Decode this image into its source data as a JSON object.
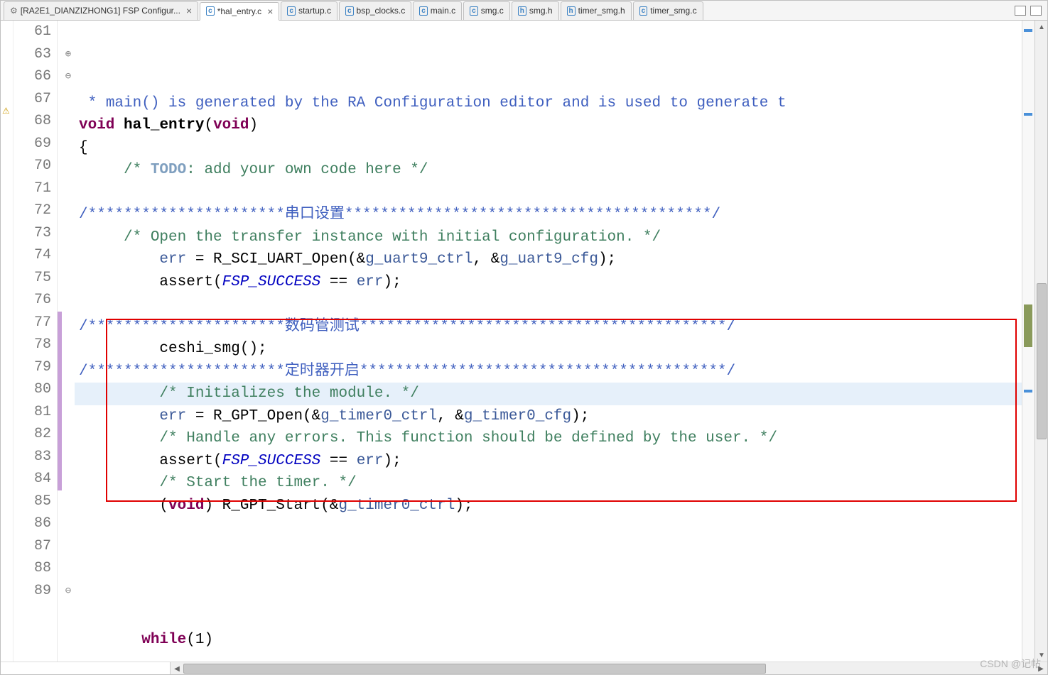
{
  "tabs": [
    {
      "label": "[RA2E1_DIANZIZHONG1] FSP Configur...",
      "icon": "gear",
      "active": false,
      "closeable": true
    },
    {
      "label": "*hal_entry.c",
      "icon": "c",
      "active": true,
      "closeable": true
    },
    {
      "label": "startup.c",
      "icon": "c",
      "active": false,
      "closeable": false
    },
    {
      "label": "bsp_clocks.c",
      "icon": "c",
      "active": false,
      "closeable": false
    },
    {
      "label": "main.c",
      "icon": "c",
      "active": false,
      "closeable": false
    },
    {
      "label": "smg.c",
      "icon": "c",
      "active": false,
      "closeable": false
    },
    {
      "label": "smg.h",
      "icon": "h",
      "active": false,
      "closeable": false
    },
    {
      "label": "timer_smg.h",
      "icon": "h",
      "active": false,
      "closeable": false
    },
    {
      "label": "timer_smg.c",
      "icon": "c",
      "active": false,
      "closeable": false
    }
  ],
  "lines": [
    {
      "num": "61",
      "fold": "",
      "ch": false,
      "cls": "",
      "html": ""
    },
    {
      "num": "63",
      "fold": "⊕",
      "ch": false,
      "cls": "",
      "html": " <span class='cm'>* main() is generated by the RA Configuration editor and is used to generate t</span>"
    },
    {
      "num": "66",
      "fold": "⊖",
      "ch": false,
      "cls": "",
      "html": "<span class='k'>void</span> <span class='fn' style='font-weight:bold'>hal_entry</span>(<span class='k'>void</span>)"
    },
    {
      "num": "67",
      "fold": "",
      "ch": false,
      "cls": "",
      "html": "{"
    },
    {
      "num": "68",
      "fold": "",
      "ch": false,
      "cls": "",
      "html": "     <span class='c'>/* </span><span class='todo'>TODO</span><span class='c'>: add your own code here */</span>"
    },
    {
      "num": "69",
      "fold": "",
      "ch": false,
      "cls": "",
      "html": ""
    },
    {
      "num": "70",
      "fold": "",
      "ch": false,
      "cls": "",
      "html": "<span class='cm'>/**********************串口设置*****************************************/</span>"
    },
    {
      "num": "71",
      "fold": "",
      "ch": false,
      "cls": "",
      "html": "     <span class='c'>/* Open the transfer instance with initial configuration. */</span>"
    },
    {
      "num": "72",
      "fold": "",
      "ch": false,
      "cls": "",
      "html": "         <span class='var'>err</span> = R_SCI_UART_Open(&amp;<span class='var'>g_uart9_ctrl</span>, &amp;<span class='var'>g_uart9_cfg</span>);"
    },
    {
      "num": "73",
      "fold": "",
      "ch": false,
      "cls": "",
      "html": "         assert(<span class='id-it'>FSP_SUCCESS</span> == <span class='var'>err</span>);"
    },
    {
      "num": "74",
      "fold": "",
      "ch": false,
      "cls": "",
      "html": ""
    },
    {
      "num": "75",
      "fold": "",
      "ch": false,
      "cls": "",
      "html": "<span class='cm'>/**********************数码管测试*****************************************/</span>"
    },
    {
      "num": "76",
      "fold": "",
      "ch": false,
      "cls": "",
      "html": "         ceshi_smg();"
    },
    {
      "num": "77",
      "fold": "",
      "ch": true,
      "cls": "",
      "html": "<span class='cm'>/**********************定时器开启*****************************************/</span>"
    },
    {
      "num": "78",
      "fold": "",
      "ch": true,
      "cls": "current",
      "html": "         <span class='c'>/* Initializes the module. */</span>"
    },
    {
      "num": "79",
      "fold": "",
      "ch": true,
      "cls": "",
      "html": "         <span class='var'>err</span> = R_GPT_Open(&amp;<span class='var'>g_timer0_ctrl</span>, &amp;<span class='var'>g_timer0_cfg</span>);"
    },
    {
      "num": "80",
      "fold": "",
      "ch": true,
      "cls": "",
      "html": "         <span class='c'>/* Handle any errors. This function should be defined by the user. */</span>"
    },
    {
      "num": "81",
      "fold": "",
      "ch": true,
      "cls": "",
      "html": "         assert(<span class='id-it'>FSP_SUCCESS</span> == <span class='var'>err</span>);"
    },
    {
      "num": "82",
      "fold": "",
      "ch": true,
      "cls": "",
      "html": "         <span class='c'>/* Start the timer. */</span>"
    },
    {
      "num": "83",
      "fold": "",
      "ch": true,
      "cls": "",
      "html": "         (<span class='k'>void</span>) R_GPT_Start(&amp;<span class='var'>g_timer0_ctrl</span>);"
    },
    {
      "num": "84",
      "fold": "",
      "ch": true,
      "cls": "",
      "html": ""
    },
    {
      "num": "85",
      "fold": "",
      "ch": false,
      "cls": "",
      "html": ""
    },
    {
      "num": "86",
      "fold": "",
      "ch": false,
      "cls": "",
      "html": ""
    },
    {
      "num": "87",
      "fold": "",
      "ch": false,
      "cls": "",
      "html": ""
    },
    {
      "num": "88",
      "fold": "",
      "ch": false,
      "cls": "",
      "html": ""
    },
    {
      "num": "89",
      "fold": "⊖",
      "ch": false,
      "cls": "",
      "html": "       <span class='k'>while</span>(1)"
    }
  ],
  "watermark": "CSDN @记帖"
}
